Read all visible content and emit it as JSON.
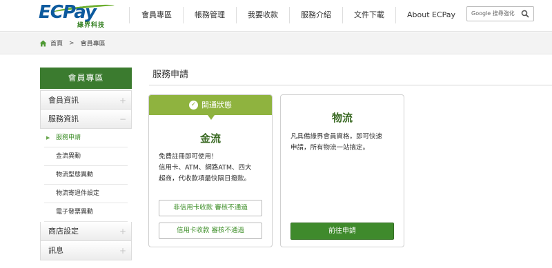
{
  "logo": {
    "brand": "ECPay",
    "subtitle": "綠界科技"
  },
  "nav": [
    "會員專區",
    "帳務管理",
    "我要收款",
    "服務介紹",
    "文件下載",
    "About ECPay"
  ],
  "search": {
    "label": "Google 搜尋強化"
  },
  "breadcrumb": {
    "home": "首頁",
    "separator": ">",
    "current": "會員專區"
  },
  "sidebar": {
    "title": "會員專區",
    "sections": [
      {
        "label": "會員資訊",
        "toggle": "+"
      },
      {
        "label": "服務資訊",
        "toggle": "−"
      }
    ],
    "subitems": [
      "服務申請",
      "金流異動",
      "物流型態異動",
      "物流寄退件設定",
      "電子發票異動"
    ],
    "bottom": [
      {
        "label": "商店設定",
        "toggle": "+"
      },
      {
        "label": "訊息",
        "toggle": "+"
      }
    ]
  },
  "page": {
    "heading": "服務申請"
  },
  "card_payment": {
    "status": "開通狀態",
    "title": "金流",
    "desc_line1": "免費註冊即可使用！",
    "desc_line2": "信用卡、ATM、網路ATM、四大",
    "desc_line3": "超商，代收款項最快隔日撥款。",
    "btn1": "非信用卡收款 審核不通過",
    "btn2": "信用卡收款 審核不通過"
  },
  "card_logistics": {
    "title": "物流",
    "desc_line1": "凡具備綠界會員資格，即可快速",
    "desc_line2": "申請，所有物流一站搞定。",
    "btn": "前往申請"
  },
  "colors": {
    "brand_green": "#3b7b2f",
    "status_green": "#8fb33f",
    "logo_blue": "#0d5a9e"
  }
}
